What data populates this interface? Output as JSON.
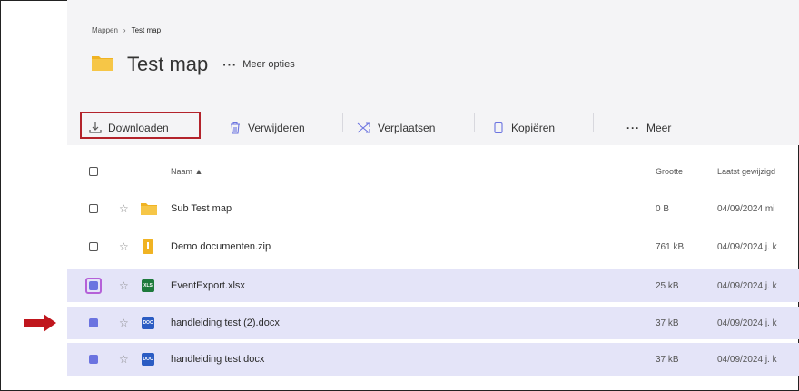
{
  "breadcrumb": {
    "root": "Mappen",
    "separator": "›",
    "current": "Test map"
  },
  "folder": {
    "title": "Test map",
    "more_label": "Meer opties",
    "more_dots": "···"
  },
  "toolbar": {
    "download": "Downloaden",
    "delete": "Verwijderen",
    "move": "Verplaatsen",
    "copy": "Kopiëren",
    "more_dots": "···",
    "more": "Meer"
  },
  "table": {
    "col_name": "Naam ▲",
    "col_size": "Grootte",
    "col_modified": "Laatst gewijzigd",
    "rows": [
      {
        "name": "Sub Test map",
        "type": "folder",
        "size": "0 B",
        "modified": "04/09/2024 mi",
        "selected": false
      },
      {
        "name": "Demo documenten.zip",
        "type": "zip",
        "size": "761 kB",
        "modified": "04/09/2024 j. k",
        "selected": false
      },
      {
        "name": "EventExport.xlsx",
        "type": "xls",
        "size": "25 kB",
        "modified": "04/09/2024 j. k",
        "selected": true
      },
      {
        "name": "handleiding test (2).docx",
        "type": "doc",
        "size": "37 kB",
        "modified": "04/09/2024 j. k",
        "selected": true
      },
      {
        "name": "handleiding test.docx",
        "type": "doc",
        "size": "37 kB",
        "modified": "04/09/2024 j. k",
        "selected": true
      }
    ]
  },
  "badges": {
    "xls": "XLS",
    "doc": "DOC"
  },
  "colors": {
    "highlight_box": "#b3232b",
    "selection": "#e4e4f8",
    "checkbox": "#6b73e0",
    "arrow": "#c0161d",
    "folder": "#f0b323"
  }
}
